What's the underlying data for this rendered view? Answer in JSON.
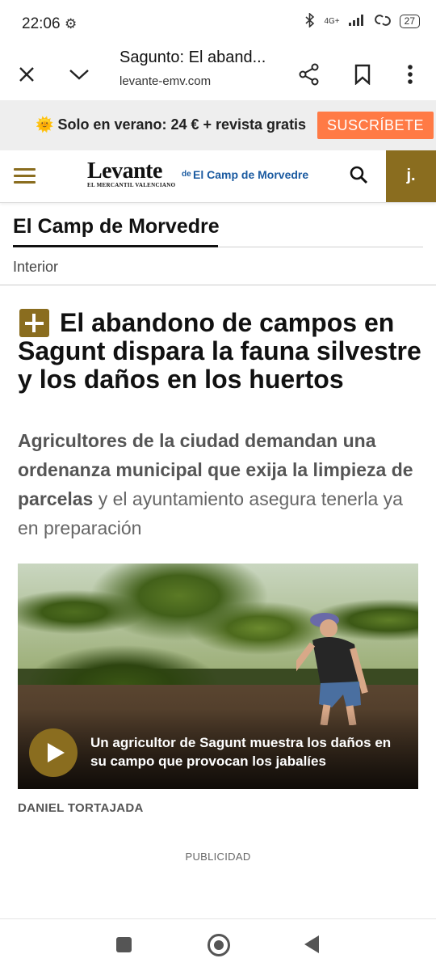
{
  "status_bar": {
    "time": "22:06",
    "network": "4G+",
    "battery": "27"
  },
  "browser": {
    "page_title": "Sagunto: El aband...",
    "url": "levante-emv.com"
  },
  "promo": {
    "emoji": "🌞",
    "text": "Solo en verano: 24 € + revista gratis",
    "button": "SUSCRÍBETE",
    "button_color": "#ff7a45"
  },
  "site_header": {
    "logo_main": "Levante",
    "logo_sub": "EL MERCANTIL VALENCIANO",
    "logo_de": "de",
    "logo_section": "El Camp de Morvedre",
    "account_initial": "j.",
    "accent_color": "#8a6d1f"
  },
  "section": {
    "title": "El Camp de Morvedre",
    "subsection": "Interior"
  },
  "article": {
    "headline": "El abandono de campos en Sagunt dispara la fauna silvestre y los daños en los huertos",
    "lead_bold": "Agricultores de la ciudad demandan una ordenanza municipal que exija la limpieza de parcelas",
    "lead_rest": " y el ayuntamiento asegura tenerla ya en preparación",
    "video_caption": "Un agricultor de Sagunt muestra los daños en su campo que provocan los jabalíes",
    "author": "DANIEL TORTAJADA",
    "ad_label": "PUBLICIDAD"
  }
}
